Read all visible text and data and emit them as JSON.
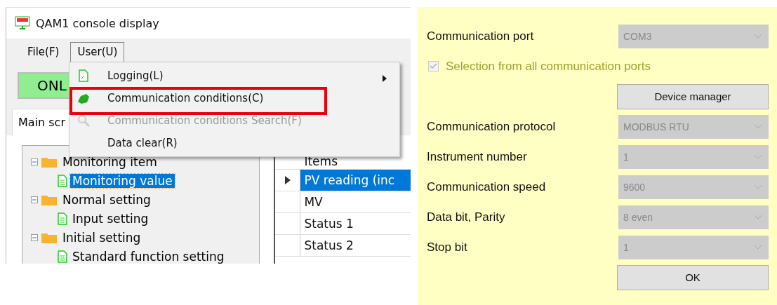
{
  "window": {
    "title": "QAM1 console display"
  },
  "menu_bar": [
    {
      "label": "File(F)",
      "selected": false
    },
    {
      "label": "User(U)",
      "selected": true
    }
  ],
  "toolbar": {
    "online_button": "ONL"
  },
  "tabs": [
    {
      "label": "Main scr",
      "selected": true
    }
  ],
  "tree": [
    {
      "label": "Monitoring item",
      "expanded": true,
      "children": [
        {
          "label": "Monitoring value",
          "selected": true
        }
      ]
    },
    {
      "label": "Normal setting",
      "expanded": true,
      "children": [
        {
          "label": "Input setting",
          "selected": false
        }
      ]
    },
    {
      "label": "Initial setting",
      "expanded": true,
      "children": [
        {
          "label": "Standard function setting",
          "selected": false
        }
      ]
    }
  ],
  "grid": {
    "columns": [
      "Items"
    ],
    "rows": [
      {
        "cells": [
          "PV reading (inc"
        ],
        "selected": true,
        "current": true
      },
      {
        "cells": [
          "MV"
        ],
        "selected": false,
        "current": false
      },
      {
        "cells": [
          "Status 1"
        ],
        "selected": false,
        "current": false
      },
      {
        "cells": [
          "Status 2"
        ],
        "selected": false,
        "current": false
      }
    ]
  },
  "user_menu": [
    {
      "label": "Logging(L)",
      "submenu": true,
      "disabled": false,
      "highlighted": false
    },
    {
      "label": "Communication conditions(C)",
      "submenu": false,
      "disabled": false,
      "highlighted": true
    },
    {
      "label": "Communication conditions Search(F)",
      "submenu": false,
      "disabled": true,
      "highlighted": false
    },
    {
      "label": "Data clear(R)",
      "submenu": false,
      "disabled": false,
      "highlighted": false
    }
  ],
  "dialog": {
    "fields": [
      {
        "kind": "select",
        "label": "Communication port",
        "value": "COM3",
        "disabled": true
      },
      {
        "kind": "checkbox",
        "label": "Selection from all communication ports",
        "checked": true,
        "disabled": true
      },
      {
        "kind": "button",
        "label": "Device manager"
      },
      {
        "kind": "select",
        "label": "Communication protocol",
        "value": "MODBUS RTU",
        "disabled": true
      },
      {
        "kind": "select",
        "label": "Instrument number",
        "value": "1",
        "disabled": true
      },
      {
        "kind": "select",
        "label": "Communication speed",
        "value": "9600",
        "disabled": true
      },
      {
        "kind": "select",
        "label": "Data bit, Parity",
        "value": "8 even",
        "disabled": true
      },
      {
        "kind": "select",
        "label": "Stop bit",
        "value": "1",
        "disabled": true
      },
      {
        "kind": "button",
        "label": "OK"
      }
    ]
  }
}
